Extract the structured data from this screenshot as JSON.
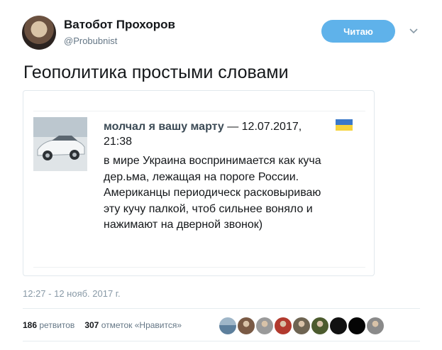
{
  "author": {
    "name": "Ватобот Прохоров",
    "handle": "@Probubnist"
  },
  "follow_button_label": "Читаю",
  "tweet_text": "Геополитика простыми словами",
  "quote": {
    "author": "молчал я вашу марту",
    "datetime": " — 12.07.2017, 21:38",
    "body": "в мире Украина воспринимается как куча дер.ьма, лежащая на пороге России. Американцы периодическ расковыриваю эту кучу палкой, чтоб сильнее воняло и нажимают на дверной звонок)"
  },
  "timestamp": "12:27 - 12 нояб. 2017 г.",
  "stats": {
    "retweets_count": "186",
    "retweets_label": "ретвитов",
    "likes_count": "307",
    "likes_label": "отметок «Нравится»"
  },
  "likers": [
    {
      "icon": "avatar-landscape",
      "color": "#5d7f9c"
    },
    {
      "icon": "avatar-face",
      "color": "#7a5a45"
    },
    {
      "icon": "avatar-face",
      "color": "#9a9a9a"
    },
    {
      "icon": "avatar-figure",
      "color": "#b23a2e"
    },
    {
      "icon": "avatar-face",
      "color": "#6e6452"
    },
    {
      "icon": "avatar-soldier",
      "color": "#4c5b2e"
    },
    {
      "icon": "avatar-dark",
      "color": "#111111"
    },
    {
      "icon": "avatar-dark",
      "color": "#050505"
    },
    {
      "icon": "avatar-dog",
      "color": "#8a8a8a"
    }
  ],
  "colors": {
    "follow_bg": "#5fb2ea",
    "flag_blue": "#3a78c9",
    "flag_yellow": "#f6d33b",
    "muted_text": "#657786"
  }
}
